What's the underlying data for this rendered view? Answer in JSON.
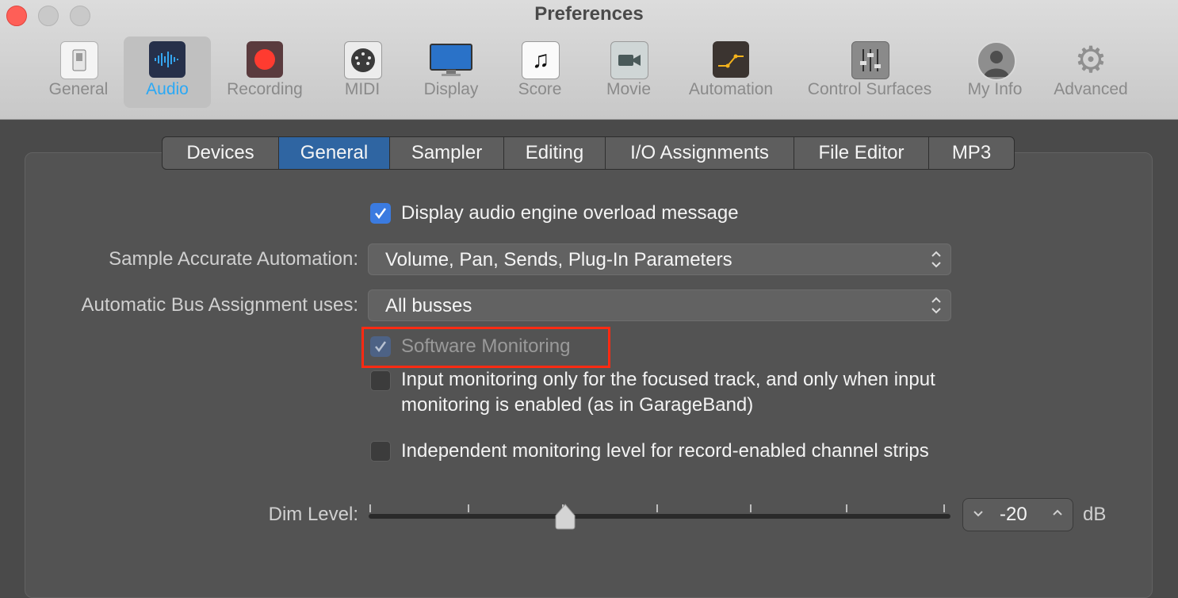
{
  "window": {
    "title": "Preferences"
  },
  "toolbar": {
    "items": [
      {
        "label": "General",
        "icon": "switch-icon"
      },
      {
        "label": "Audio",
        "icon": "waveform-icon",
        "selected": true
      },
      {
        "label": "Recording",
        "icon": "record-icon"
      },
      {
        "label": "MIDI",
        "icon": "midi-connector-icon"
      },
      {
        "label": "Display",
        "icon": "monitor-icon"
      },
      {
        "label": "Score",
        "icon": "music-note-icon"
      },
      {
        "label": "Movie",
        "icon": "video-camera-icon"
      },
      {
        "label": "Automation",
        "icon": "automation-curve-icon"
      },
      {
        "label": "Control Surfaces",
        "icon": "faders-icon"
      },
      {
        "label": "My Info",
        "icon": "user-icon"
      },
      {
        "label": "Advanced",
        "icon": "gear-icon"
      }
    ],
    "selected_color": "#2aa8f5"
  },
  "tabs": {
    "items": [
      "Devices",
      "General",
      "Sampler",
      "Editing",
      "I/O Assignments",
      "File Editor",
      "MP3"
    ],
    "active": "General",
    "active_color": "#2f65a2"
  },
  "general": {
    "overload_message": {
      "label": "Display audio engine overload message",
      "checked": true
    },
    "sample_accurate_automation": {
      "label": "Sample Accurate Automation:",
      "value": "Volume, Pan, Sends, Plug-In Parameters"
    },
    "bus_assignment": {
      "label": "Automatic Bus Assignment uses:",
      "value": "All busses"
    },
    "software_monitoring": {
      "label": "Software Monitoring",
      "checked": true,
      "enabled": false
    },
    "input_monitoring_focused": {
      "label_line1": "Input monitoring only for the focused track, and only when input",
      "label_line2": "monitoring is enabled (as in GarageBand)",
      "checked": false
    },
    "independent_monitoring": {
      "label": "Independent monitoring level for record-enabled channel strips",
      "checked": false
    },
    "dim_level": {
      "label": "Dim Level:",
      "value": "-20",
      "unit": "dB",
      "slider_fraction": 0.34
    }
  },
  "annotation": {
    "highlight_color": "#ff2a12"
  }
}
